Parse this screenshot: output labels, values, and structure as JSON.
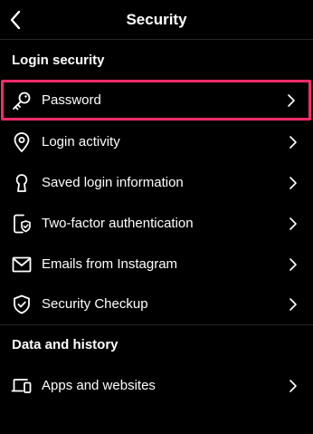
{
  "header": {
    "title": "Security"
  },
  "sections": [
    {
      "title": "Login security",
      "items": [
        {
          "label": "Password",
          "icon": "key-icon"
        },
        {
          "label": "Login activity",
          "icon": "location-pin-icon"
        },
        {
          "label": "Saved login information",
          "icon": "keyhole-icon"
        },
        {
          "label": "Two-factor authentication",
          "icon": "phone-shield-icon"
        },
        {
          "label": "Emails from Instagram",
          "icon": "envelope-icon"
        },
        {
          "label": "Security Checkup",
          "icon": "shield-check-icon"
        }
      ]
    },
    {
      "title": "Data and history",
      "items": [
        {
          "label": "Apps and websites",
          "icon": "devices-icon"
        }
      ]
    }
  ],
  "colors": {
    "background": "#000000",
    "text": "#ffffff",
    "highlight": "#ff2b6a",
    "divider": "#262626"
  }
}
